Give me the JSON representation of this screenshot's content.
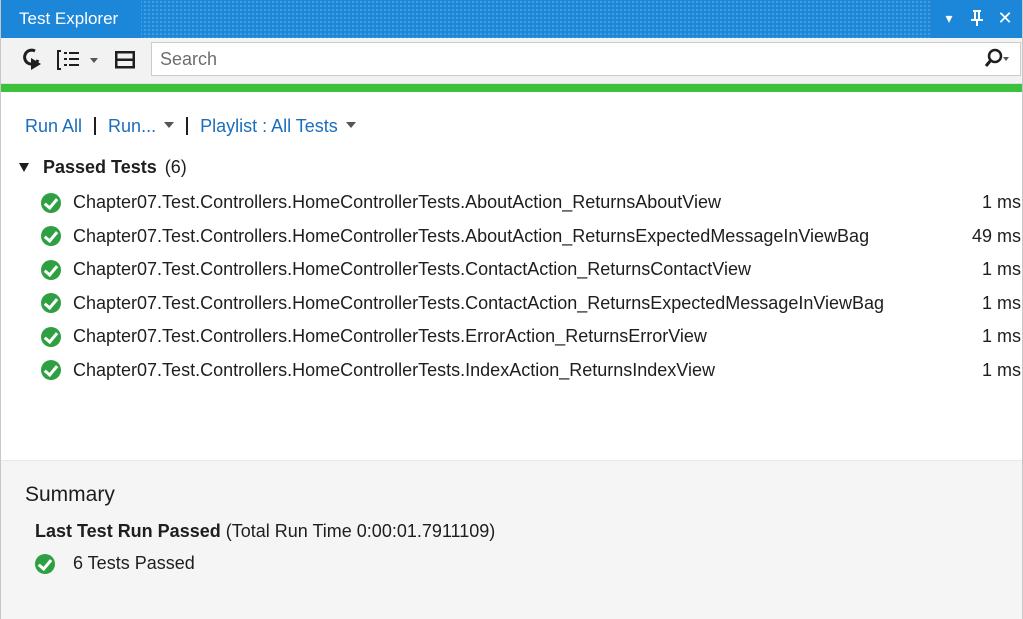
{
  "window": {
    "title": "Test Explorer",
    "title_buttons": [
      "▾",
      "⇩",
      "✕"
    ]
  },
  "toolbar": {
    "search_placeholder": "Search",
    "icons": [
      "run-tests-icon",
      "group-by-icon",
      "dropdown-icon",
      "list-view-icon",
      "search-icon"
    ]
  },
  "progress": {
    "fraction": 1.0,
    "color": "#3cc13c"
  },
  "commands": {
    "run_all": "Run All",
    "run": "Run...",
    "playlist": "Playlist : All Tests"
  },
  "group": {
    "title": "Passed Tests",
    "count": "(6)"
  },
  "tests": [
    {
      "name": "Chapter07.Test.Controllers.HomeControllerTests.AboutAction_ReturnsAboutView",
      "time": "1 ms"
    },
    {
      "name": "Chapter07.Test.Controllers.HomeControllerTests.AboutAction_ReturnsExpectedMessageInViewBag",
      "time": "49 ms"
    },
    {
      "name": "Chapter07.Test.Controllers.HomeControllerTests.ContactAction_ReturnsContactView",
      "time": "1 ms"
    },
    {
      "name": "Chapter07.Test.Controllers.HomeControllerTests.ContactAction_ReturnsExpectedMessageInViewBag",
      "time": "1 ms"
    },
    {
      "name": "Chapter07.Test.Controllers.HomeControllerTests.ErrorAction_ReturnsErrorView",
      "time": "1 ms"
    },
    {
      "name": "Chapter07.Test.Controllers.HomeControllerTests.IndexAction_ReturnsIndexView",
      "time": "1 ms"
    }
  ],
  "summary": {
    "title": "Summary",
    "last_run_label": "Last Test Run Passed",
    "last_run_detail": "(Total Run Time 0:00:01.7911109)",
    "passed_count": "6 Tests Passed"
  },
  "colors": {
    "titlebar": "#1c87d8",
    "link": "#1a6ebd",
    "pass": "#2ea043"
  }
}
